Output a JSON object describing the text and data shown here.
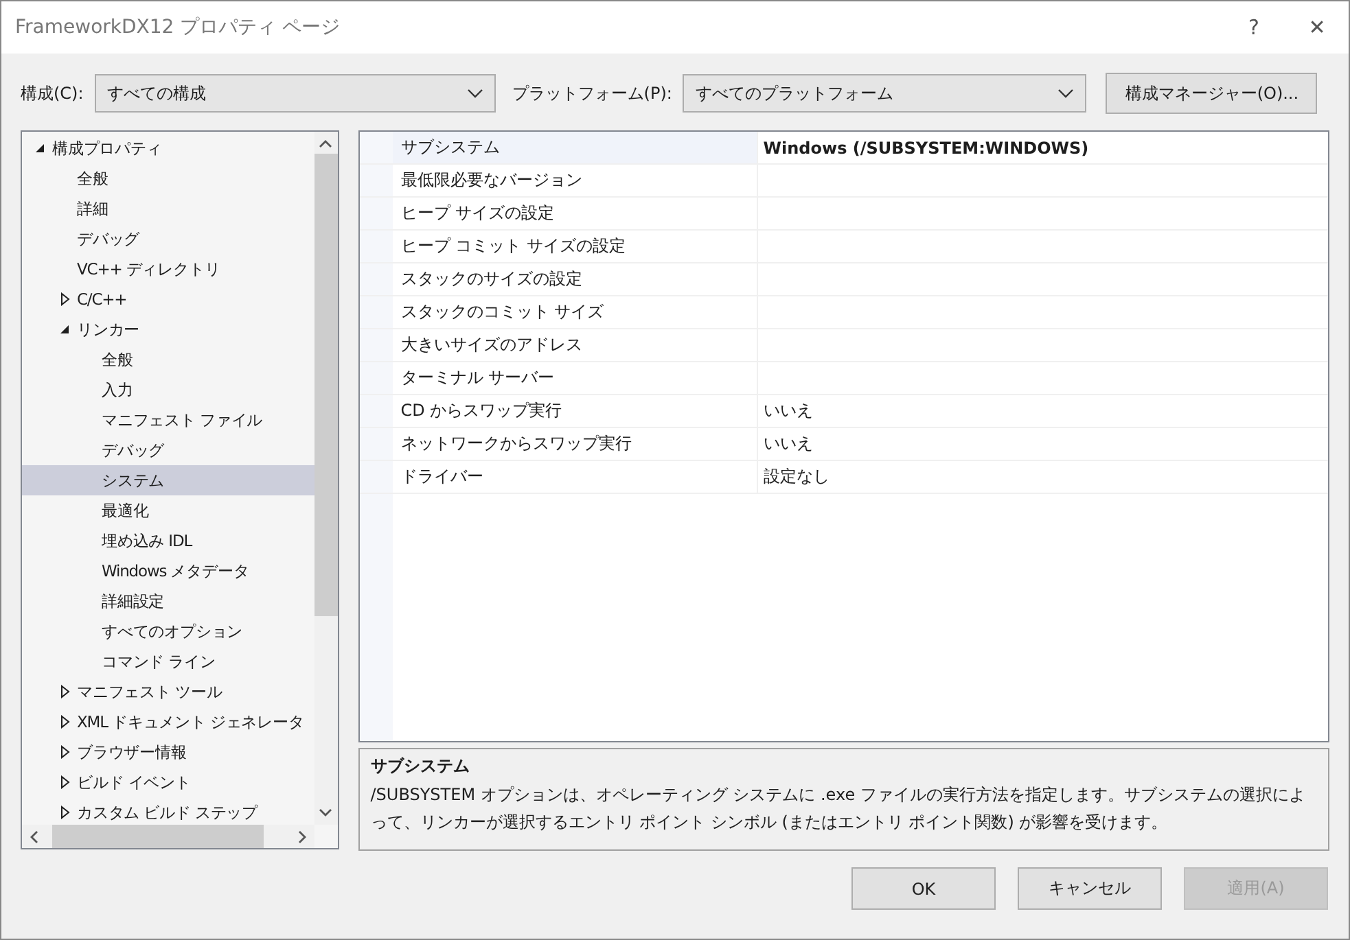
{
  "window": {
    "title": "FrameworkDX12 プロパティ ページ",
    "help": "?",
    "close": "✕"
  },
  "toolbar": {
    "configuration_label": "構成(C):",
    "configuration_value": "すべての構成",
    "platform_label": "プラットフォーム(P):",
    "platform_value": "すべてのプラットフォーム",
    "manager_button": "構成マネージャー(O)..."
  },
  "tree": [
    {
      "label": "構成プロパティ",
      "expanded": true,
      "selected": false,
      "children": [
        {
          "label": "全般",
          "selected": false
        },
        {
          "label": "詳細",
          "selected": false
        },
        {
          "label": "デバッグ",
          "selected": false
        },
        {
          "label": "VC++ ディレクトリ",
          "selected": false
        },
        {
          "label": "C/C++",
          "expanded": false,
          "selected": false
        },
        {
          "label": "リンカー",
          "expanded": true,
          "selected": false,
          "children": [
            {
              "label": "全般",
              "selected": false
            },
            {
              "label": "入力",
              "selected": false
            },
            {
              "label": "マニフェスト ファイル",
              "selected": false
            },
            {
              "label": "デバッグ",
              "selected": false
            },
            {
              "label": "システム",
              "selected": true
            },
            {
              "label": "最適化",
              "selected": false
            },
            {
              "label": "埋め込み IDL",
              "selected": false
            },
            {
              "label": "Windows メタデータ",
              "selected": false
            },
            {
              "label": "詳細設定",
              "selected": false
            },
            {
              "label": "すべてのオプション",
              "selected": false
            },
            {
              "label": "コマンド ライン",
              "selected": false
            }
          ]
        },
        {
          "label": "マニフェスト ツール",
          "expanded": false,
          "selected": false
        },
        {
          "label": "XML ドキュメント ジェネレータ",
          "expanded": false,
          "selected": false
        },
        {
          "label": "ブラウザー情報",
          "expanded": false,
          "selected": false
        },
        {
          "label": "ビルド イベント",
          "expanded": false,
          "selected": false
        },
        {
          "label": "カスタム ビルド ステップ",
          "expanded": false,
          "selected": false
        }
      ]
    }
  ],
  "properties": [
    {
      "name": "サブシステム",
      "value": "Windows (/SUBSYSTEM:WINDOWS)",
      "selected": true,
      "modified": true
    },
    {
      "name": "最低限必要なバージョン",
      "selected": false
    },
    {
      "name": "ヒープ サイズの設定",
      "selected": false
    },
    {
      "name": "ヒープ コミット サイズの設定",
      "selected": false
    },
    {
      "name": "スタックのサイズの設定",
      "selected": false
    },
    {
      "name": "スタックのコミット サイズ",
      "selected": false
    },
    {
      "name": "大きいサイズのアドレス",
      "selected": false
    },
    {
      "name": "ターミナル サーバー",
      "selected": false
    },
    {
      "name": "CD からスワップ実行",
      "value": "いいえ",
      "selected": false,
      "modified": false
    },
    {
      "name": "ネットワークからスワップ実行",
      "value": "いいえ",
      "selected": false,
      "modified": false
    },
    {
      "name": "ドライバー",
      "value": "設定なし",
      "selected": false,
      "modified": false
    }
  ],
  "description": {
    "title": "サブシステム",
    "text": "/SUBSYSTEM オプションは、オペレーティング システムに .exe ファイルの実行方法を指定します。サブシステムの選択によって、リンカーが選択するエントリ ポイント シンボル (またはエントリ ポイント関数) が影響を受けます。"
  },
  "buttons": [
    {
      "label": "OK",
      "disabled": false
    },
    {
      "label": "キャンセル",
      "disabled": false
    },
    {
      "label": "適用(A)",
      "disabled": true
    }
  ]
}
